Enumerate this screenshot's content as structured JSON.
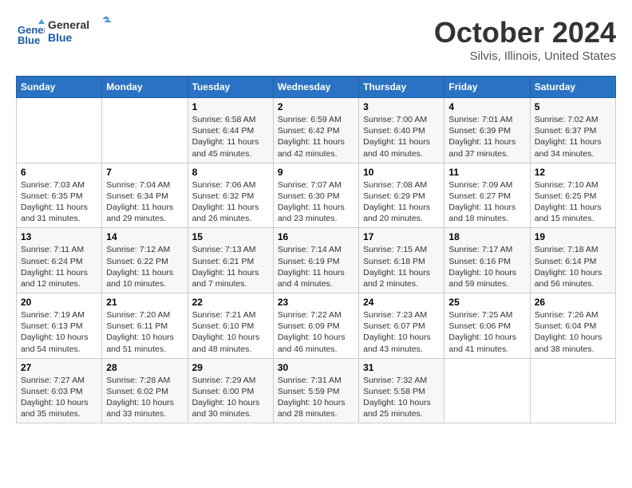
{
  "header": {
    "logo_line1": "General",
    "logo_line2": "Blue",
    "month": "October 2024",
    "location": "Silvis, Illinois, United States"
  },
  "weekdays": [
    "Sunday",
    "Monday",
    "Tuesday",
    "Wednesday",
    "Thursday",
    "Friday",
    "Saturday"
  ],
  "weeks": [
    [
      {
        "day": "",
        "info": ""
      },
      {
        "day": "",
        "info": ""
      },
      {
        "day": "1",
        "info": "Sunrise: 6:58 AM\nSunset: 6:44 PM\nDaylight: 11 hours and 45 minutes."
      },
      {
        "day": "2",
        "info": "Sunrise: 6:59 AM\nSunset: 6:42 PM\nDaylight: 11 hours and 42 minutes."
      },
      {
        "day": "3",
        "info": "Sunrise: 7:00 AM\nSunset: 6:40 PM\nDaylight: 11 hours and 40 minutes."
      },
      {
        "day": "4",
        "info": "Sunrise: 7:01 AM\nSunset: 6:39 PM\nDaylight: 11 hours and 37 minutes."
      },
      {
        "day": "5",
        "info": "Sunrise: 7:02 AM\nSunset: 6:37 PM\nDaylight: 11 hours and 34 minutes."
      }
    ],
    [
      {
        "day": "6",
        "info": "Sunrise: 7:03 AM\nSunset: 6:35 PM\nDaylight: 11 hours and 31 minutes."
      },
      {
        "day": "7",
        "info": "Sunrise: 7:04 AM\nSunset: 6:34 PM\nDaylight: 11 hours and 29 minutes."
      },
      {
        "day": "8",
        "info": "Sunrise: 7:06 AM\nSunset: 6:32 PM\nDaylight: 11 hours and 26 minutes."
      },
      {
        "day": "9",
        "info": "Sunrise: 7:07 AM\nSunset: 6:30 PM\nDaylight: 11 hours and 23 minutes."
      },
      {
        "day": "10",
        "info": "Sunrise: 7:08 AM\nSunset: 6:29 PM\nDaylight: 11 hours and 20 minutes."
      },
      {
        "day": "11",
        "info": "Sunrise: 7:09 AM\nSunset: 6:27 PM\nDaylight: 11 hours and 18 minutes."
      },
      {
        "day": "12",
        "info": "Sunrise: 7:10 AM\nSunset: 6:25 PM\nDaylight: 11 hours and 15 minutes."
      }
    ],
    [
      {
        "day": "13",
        "info": "Sunrise: 7:11 AM\nSunset: 6:24 PM\nDaylight: 11 hours and 12 minutes."
      },
      {
        "day": "14",
        "info": "Sunrise: 7:12 AM\nSunset: 6:22 PM\nDaylight: 11 hours and 10 minutes."
      },
      {
        "day": "15",
        "info": "Sunrise: 7:13 AM\nSunset: 6:21 PM\nDaylight: 11 hours and 7 minutes."
      },
      {
        "day": "16",
        "info": "Sunrise: 7:14 AM\nSunset: 6:19 PM\nDaylight: 11 hours and 4 minutes."
      },
      {
        "day": "17",
        "info": "Sunrise: 7:15 AM\nSunset: 6:18 PM\nDaylight: 11 hours and 2 minutes."
      },
      {
        "day": "18",
        "info": "Sunrise: 7:17 AM\nSunset: 6:16 PM\nDaylight: 10 hours and 59 minutes."
      },
      {
        "day": "19",
        "info": "Sunrise: 7:18 AM\nSunset: 6:14 PM\nDaylight: 10 hours and 56 minutes."
      }
    ],
    [
      {
        "day": "20",
        "info": "Sunrise: 7:19 AM\nSunset: 6:13 PM\nDaylight: 10 hours and 54 minutes."
      },
      {
        "day": "21",
        "info": "Sunrise: 7:20 AM\nSunset: 6:11 PM\nDaylight: 10 hours and 51 minutes."
      },
      {
        "day": "22",
        "info": "Sunrise: 7:21 AM\nSunset: 6:10 PM\nDaylight: 10 hours and 48 minutes."
      },
      {
        "day": "23",
        "info": "Sunrise: 7:22 AM\nSunset: 6:09 PM\nDaylight: 10 hours and 46 minutes."
      },
      {
        "day": "24",
        "info": "Sunrise: 7:23 AM\nSunset: 6:07 PM\nDaylight: 10 hours and 43 minutes."
      },
      {
        "day": "25",
        "info": "Sunrise: 7:25 AM\nSunset: 6:06 PM\nDaylight: 10 hours and 41 minutes."
      },
      {
        "day": "26",
        "info": "Sunrise: 7:26 AM\nSunset: 6:04 PM\nDaylight: 10 hours and 38 minutes."
      }
    ],
    [
      {
        "day": "27",
        "info": "Sunrise: 7:27 AM\nSunset: 6:03 PM\nDaylight: 10 hours and 35 minutes."
      },
      {
        "day": "28",
        "info": "Sunrise: 7:28 AM\nSunset: 6:02 PM\nDaylight: 10 hours and 33 minutes."
      },
      {
        "day": "29",
        "info": "Sunrise: 7:29 AM\nSunset: 6:00 PM\nDaylight: 10 hours and 30 minutes."
      },
      {
        "day": "30",
        "info": "Sunrise: 7:31 AM\nSunset: 5:59 PM\nDaylight: 10 hours and 28 minutes."
      },
      {
        "day": "31",
        "info": "Sunrise: 7:32 AM\nSunset: 5:58 PM\nDaylight: 10 hours and 25 minutes."
      },
      {
        "day": "",
        "info": ""
      },
      {
        "day": "",
        "info": ""
      }
    ]
  ]
}
